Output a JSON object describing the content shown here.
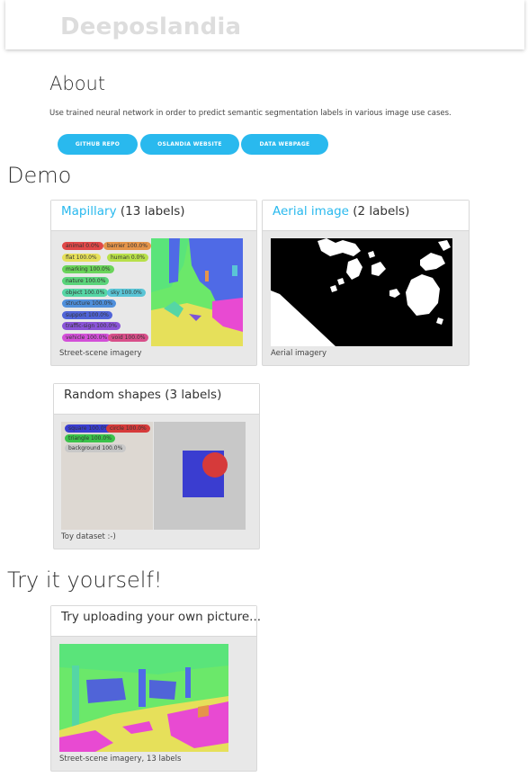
{
  "header": {
    "brand": "Deeposlandia"
  },
  "about": {
    "title": "About",
    "text": "Use trained neural network in order to predict semantic segmentation labels in various image use cases.",
    "buttons": [
      "GITHUB REPO",
      "OSLANDIA WEBSITE",
      "DATA WEBPAGE"
    ]
  },
  "demo": {
    "title": "Demo",
    "cards": [
      {
        "link": "Mapillary",
        "suffix": " (13 labels)",
        "caption": "Street-scene imagery",
        "tags": [
          {
            "text": "animal 0.0%",
            "color": "#e04848"
          },
          {
            "text": "barrier 100.0%",
            "color": "#e5944a"
          },
          {
            "text": "flat 100.0%",
            "color": "#e6e05a"
          },
          {
            "text": "human 0.0%",
            "color": "#b8e04a"
          },
          {
            "text": "marking 100.0%",
            "color": "#6ad45a"
          },
          {
            "text": "nature 100.0%",
            "color": "#5ad47a"
          },
          {
            "text": "object 100.0%",
            "color": "#55d6a5"
          },
          {
            "text": "sky 100.0%",
            "color": "#5ac5d6"
          },
          {
            "text": "structure 100.0%",
            "color": "#4f8fdb"
          },
          {
            "text": "support 100.0%",
            "color": "#5064d8"
          },
          {
            "text": "traffic-sign 100.0%",
            "color": "#8a54d8"
          },
          {
            "text": "vehicle 100.0%",
            "color": "#d34fd8"
          },
          {
            "text": "void 100.0%",
            "color": "#d84f8a"
          }
        ]
      },
      {
        "link": "Aerial image",
        "suffix": " (2 labels)",
        "caption": "Aerial imagery"
      },
      {
        "link": "",
        "suffix": "Random shapes (3 labels)",
        "caption": "Toy dataset :-)",
        "tags": [
          {
            "text": "square 100.0%",
            "color": "#3a3dd0"
          },
          {
            "text": "circle 100.0%",
            "color": "#d63a3a"
          },
          {
            "text": "triangle 100.0%",
            "color": "#3ac24a"
          },
          {
            "text": "background 100.0%",
            "color": "#c8c8c8"
          }
        ]
      }
    ]
  },
  "try": {
    "title": "Try it yourself!",
    "card_title": "Try uploading your own picture...",
    "caption": "Street-scene imagery, 13 labels"
  },
  "colors": {
    "accent": "#29b9ee",
    "card_bg": "#e8e8e8"
  }
}
